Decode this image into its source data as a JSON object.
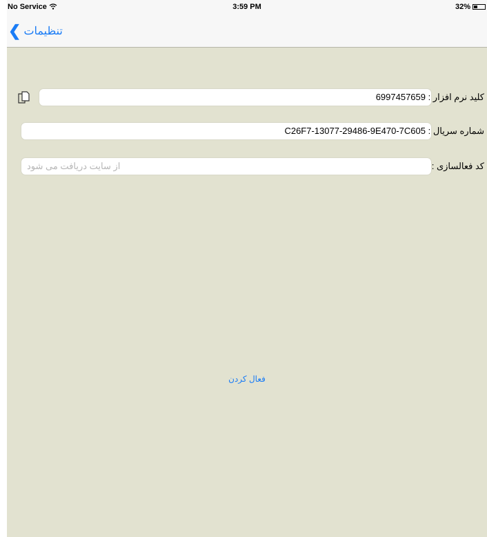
{
  "status_bar": {
    "carrier": "No Service",
    "time": "3:59 PM",
    "battery": "32%",
    "battery_level": 0.32
  },
  "nav": {
    "back_label": "تنظیمات"
  },
  "form": {
    "software_key_label": "کلید نرم افزار :",
    "software_key_value": "6997457659",
    "serial_label": "شماره سریال :",
    "serial_value": "C26F7-13077-29486-9E470-7C605",
    "activation_label": "کد فعالسازی :",
    "activation_placeholder": "از سایت دریافت می شود"
  },
  "activate_button": "فعال کردن",
  "icons": {
    "wifi": "wifi-icon",
    "battery": "battery-icon",
    "back": "chevron-left-icon",
    "copy": "copy-icon"
  },
  "colors": {
    "accent": "#1a7cf6",
    "background": "#e2e2d0"
  }
}
